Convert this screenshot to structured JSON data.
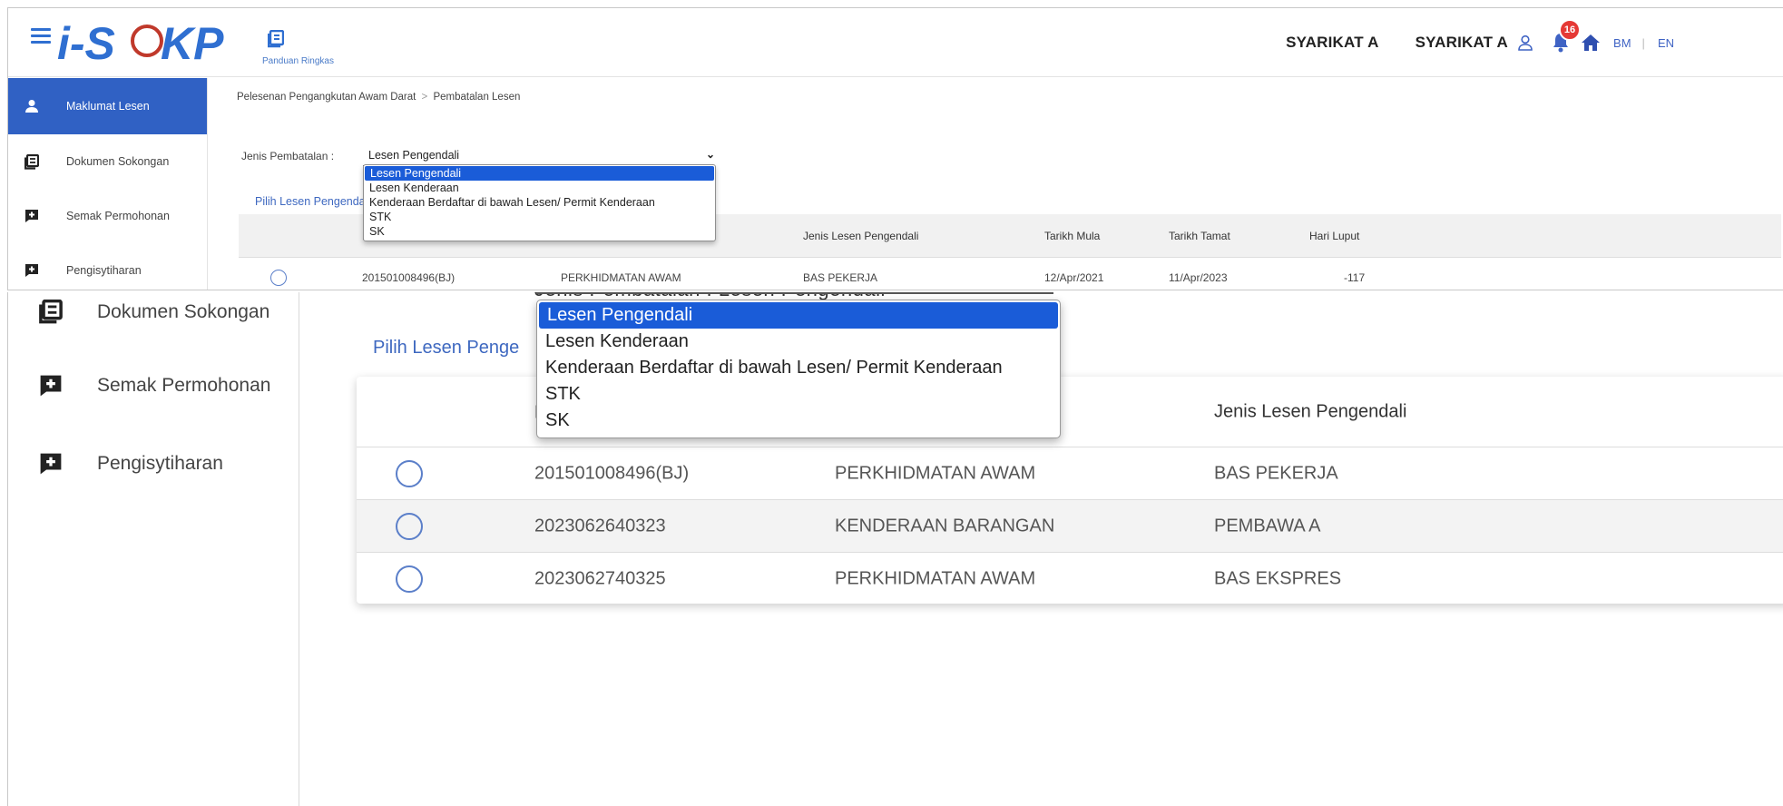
{
  "header": {
    "logo_text": "i-SPKP",
    "quick_guide_label": "Panduan Ringkas",
    "company_1": "SYARIKAT A",
    "company_2": "SYARIKAT A",
    "notification_count": "16",
    "lang_bm": "BM",
    "lang_separator": "|",
    "lang_en": "EN"
  },
  "sidebar": {
    "items": [
      {
        "label": "Maklumat Lesen",
        "icon": "user-icon",
        "active": true
      },
      {
        "label": "Dokumen Sokongan",
        "icon": "document-icon"
      },
      {
        "label": "Semak Permohonan",
        "icon": "comment-plus-icon"
      },
      {
        "label": "Pengisytiharan",
        "icon": "comment-plus-icon"
      }
    ]
  },
  "breadcrumb": {
    "parent": "Pelesenan Pengangkutan Awam Darat",
    "separator": ">",
    "current": "Pembatalan Lesen"
  },
  "form": {
    "jenis_label": "Jenis Pembatalan :",
    "selected_value": "Lesen Pengendali",
    "pilih_label": "Pilih Lesen Pengendali",
    "pilih_label_visible": "Pilih Lesen Penge",
    "options": [
      "Lesen Pengendali",
      "Lesen Kenderaan",
      "Kenderaan Berdaftar di bawah Lesen/ Permit Kenderaan",
      "STK",
      "SK"
    ]
  },
  "table": {
    "columns": [
      "",
      "N",
      "",
      "Jenis Lesen Pengendali",
      "Tarikh Mula",
      "Tarikh Tamat",
      "Hari Luput"
    ],
    "rows": [
      {
        "no": "201501008496(BJ)",
        "kategori": "PERKHIDMATAN AWAM",
        "jenis": "BAS PEKERJA",
        "mula": "12/Apr/2021",
        "tamat": "11/Apr/2023",
        "luput": "-117"
      },
      {
        "no": "2023062640323",
        "kategori": "KENDERAAN BARANGAN",
        "jenis": "PEMBAWA A"
      },
      {
        "no": "2023062740325",
        "kategori": "PERKHIDMATAN AWAM",
        "jenis": "BAS EKSPRES"
      }
    ]
  },
  "zoom": {
    "cut_text": "Jenis Pembatalan : Lesen Pengendali"
  },
  "colors": {
    "primary": "#3061c4",
    "selected_option": "#1a5cd8",
    "badge": "#e53935"
  }
}
